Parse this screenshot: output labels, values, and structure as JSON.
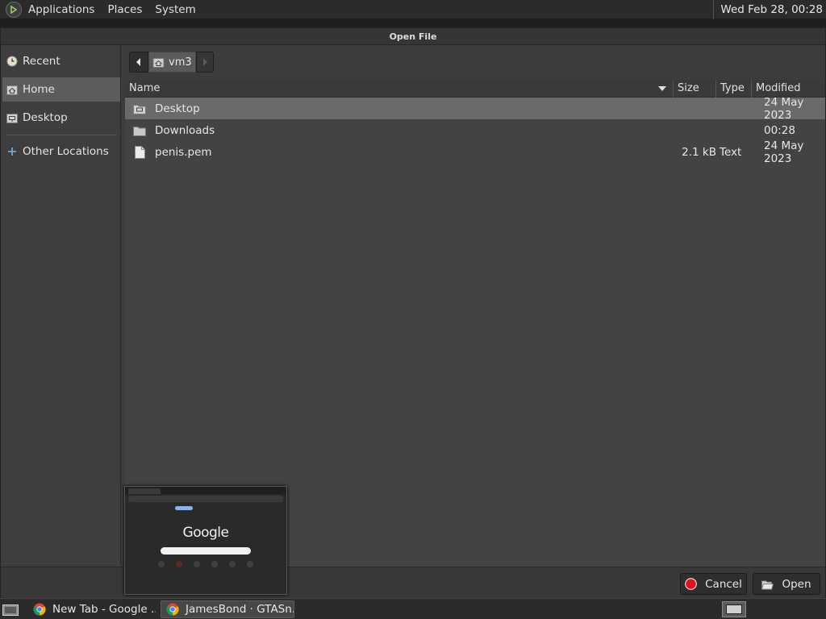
{
  "top_panel": {
    "menus": [
      "Applications",
      "Places",
      "System"
    ],
    "clock": "Wed Feb 28, 00:28"
  },
  "dialog": {
    "title": "Open File",
    "sidebar": {
      "items": [
        {
          "label": "Recent",
          "icon": "clock-icon"
        },
        {
          "label": "Home",
          "icon": "home-folder-icon",
          "selected": true
        },
        {
          "label": "Desktop",
          "icon": "desktop-folder-icon"
        },
        {
          "label": "Other Locations",
          "icon": "plus-icon"
        }
      ]
    },
    "pathbar": {
      "current": "vm3"
    },
    "columns": {
      "name": "Name",
      "size": "Size",
      "type": "Type",
      "modified": "Modified"
    },
    "files": [
      {
        "name": "Desktop",
        "size": "",
        "type": "",
        "modified": "24 May 2023",
        "icon": "desktop-folder-icon",
        "selected": true
      },
      {
        "name": "Downloads",
        "size": "",
        "type": "",
        "modified": "00:28",
        "icon": "folder-icon"
      },
      {
        "name": "penis.pem",
        "size": "2.1 kB",
        "type": "Text",
        "modified": "24 May 2023",
        "icon": "text-file-icon"
      }
    ],
    "buttons": {
      "cancel": "Cancel",
      "open": "Open"
    }
  },
  "thumbnail": {
    "logo": "Google"
  },
  "taskbar": {
    "tasks": [
      {
        "label": "New Tab - Google ..."
      },
      {
        "label": "JamesBond · GTASn...",
        "active": true
      }
    ]
  },
  "colors": {
    "cancel_red": "#e0121b",
    "chrome_red": "#db4437",
    "chrome_yellow": "#f4b400",
    "chrome_green": "#0f9d58",
    "chrome_blue": "#4285f4"
  }
}
